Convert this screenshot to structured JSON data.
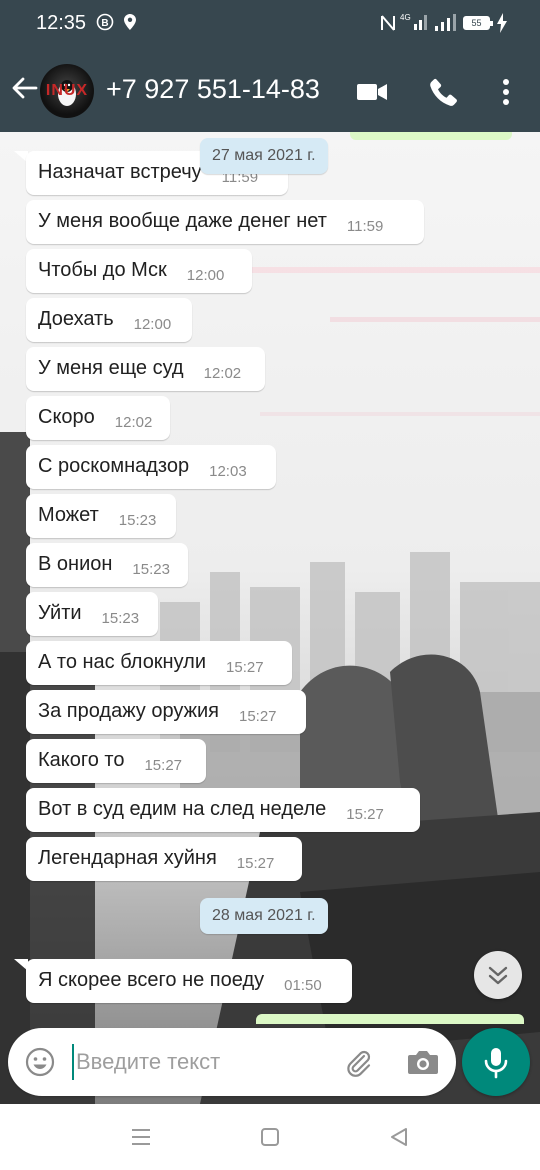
{
  "status_bar": {
    "time": "12:35",
    "battery": "55",
    "icons": [
      "b-circle-icon",
      "location-icon",
      "nfc-icon",
      "signal-4g-icon",
      "signal-icon",
      "battery-icon",
      "charging-icon"
    ]
  },
  "header": {
    "contact": "+7 927 551-14-83",
    "avatar_text": "INUX",
    "actions": [
      "video-call-icon",
      "phone-icon",
      "more-icon"
    ]
  },
  "chat": {
    "date_1": "27 мая 2021 г.",
    "date_2": "28 мая 2021 г.",
    "messages": [
      {
        "text": "Назначат встречу",
        "time": "11:59"
      },
      {
        "text": "У меня вообще даже денег нет",
        "time": "11:59"
      },
      {
        "text": "Чтобы до Мск",
        "time": "12:00"
      },
      {
        "text": "Доехать",
        "time": "12:00"
      },
      {
        "text": "У меня еще суд",
        "time": "12:02"
      },
      {
        "text": "Скоро",
        "time": "12:02"
      },
      {
        "text": "С роскомнадзор",
        "time": "12:03"
      },
      {
        "text": "Может",
        "time": "15:23"
      },
      {
        "text": "В онион",
        "time": "15:23"
      },
      {
        "text": "Уйти",
        "time": "15:23"
      },
      {
        "text": "А то нас блокнули",
        "time": "15:27"
      },
      {
        "text": "За продажу оружия",
        "time": "15:27"
      },
      {
        "text": "Какого то",
        "time": "15:27"
      },
      {
        "text": "Вот в суд едим на след неделе",
        "time": "15:27"
      },
      {
        "text": "Легендарная хуйня",
        "time": "15:27"
      },
      {
        "text": "Я скорее всего не поеду",
        "time": "01:50"
      }
    ]
  },
  "input": {
    "placeholder": "Введите текст"
  },
  "colors": {
    "header_bg": "#37474f",
    "accent": "#00897b",
    "incoming_bubble": "#ffffff",
    "outgoing_bubble": "#dcf8c6",
    "date_chip": "#d6eaf5"
  }
}
